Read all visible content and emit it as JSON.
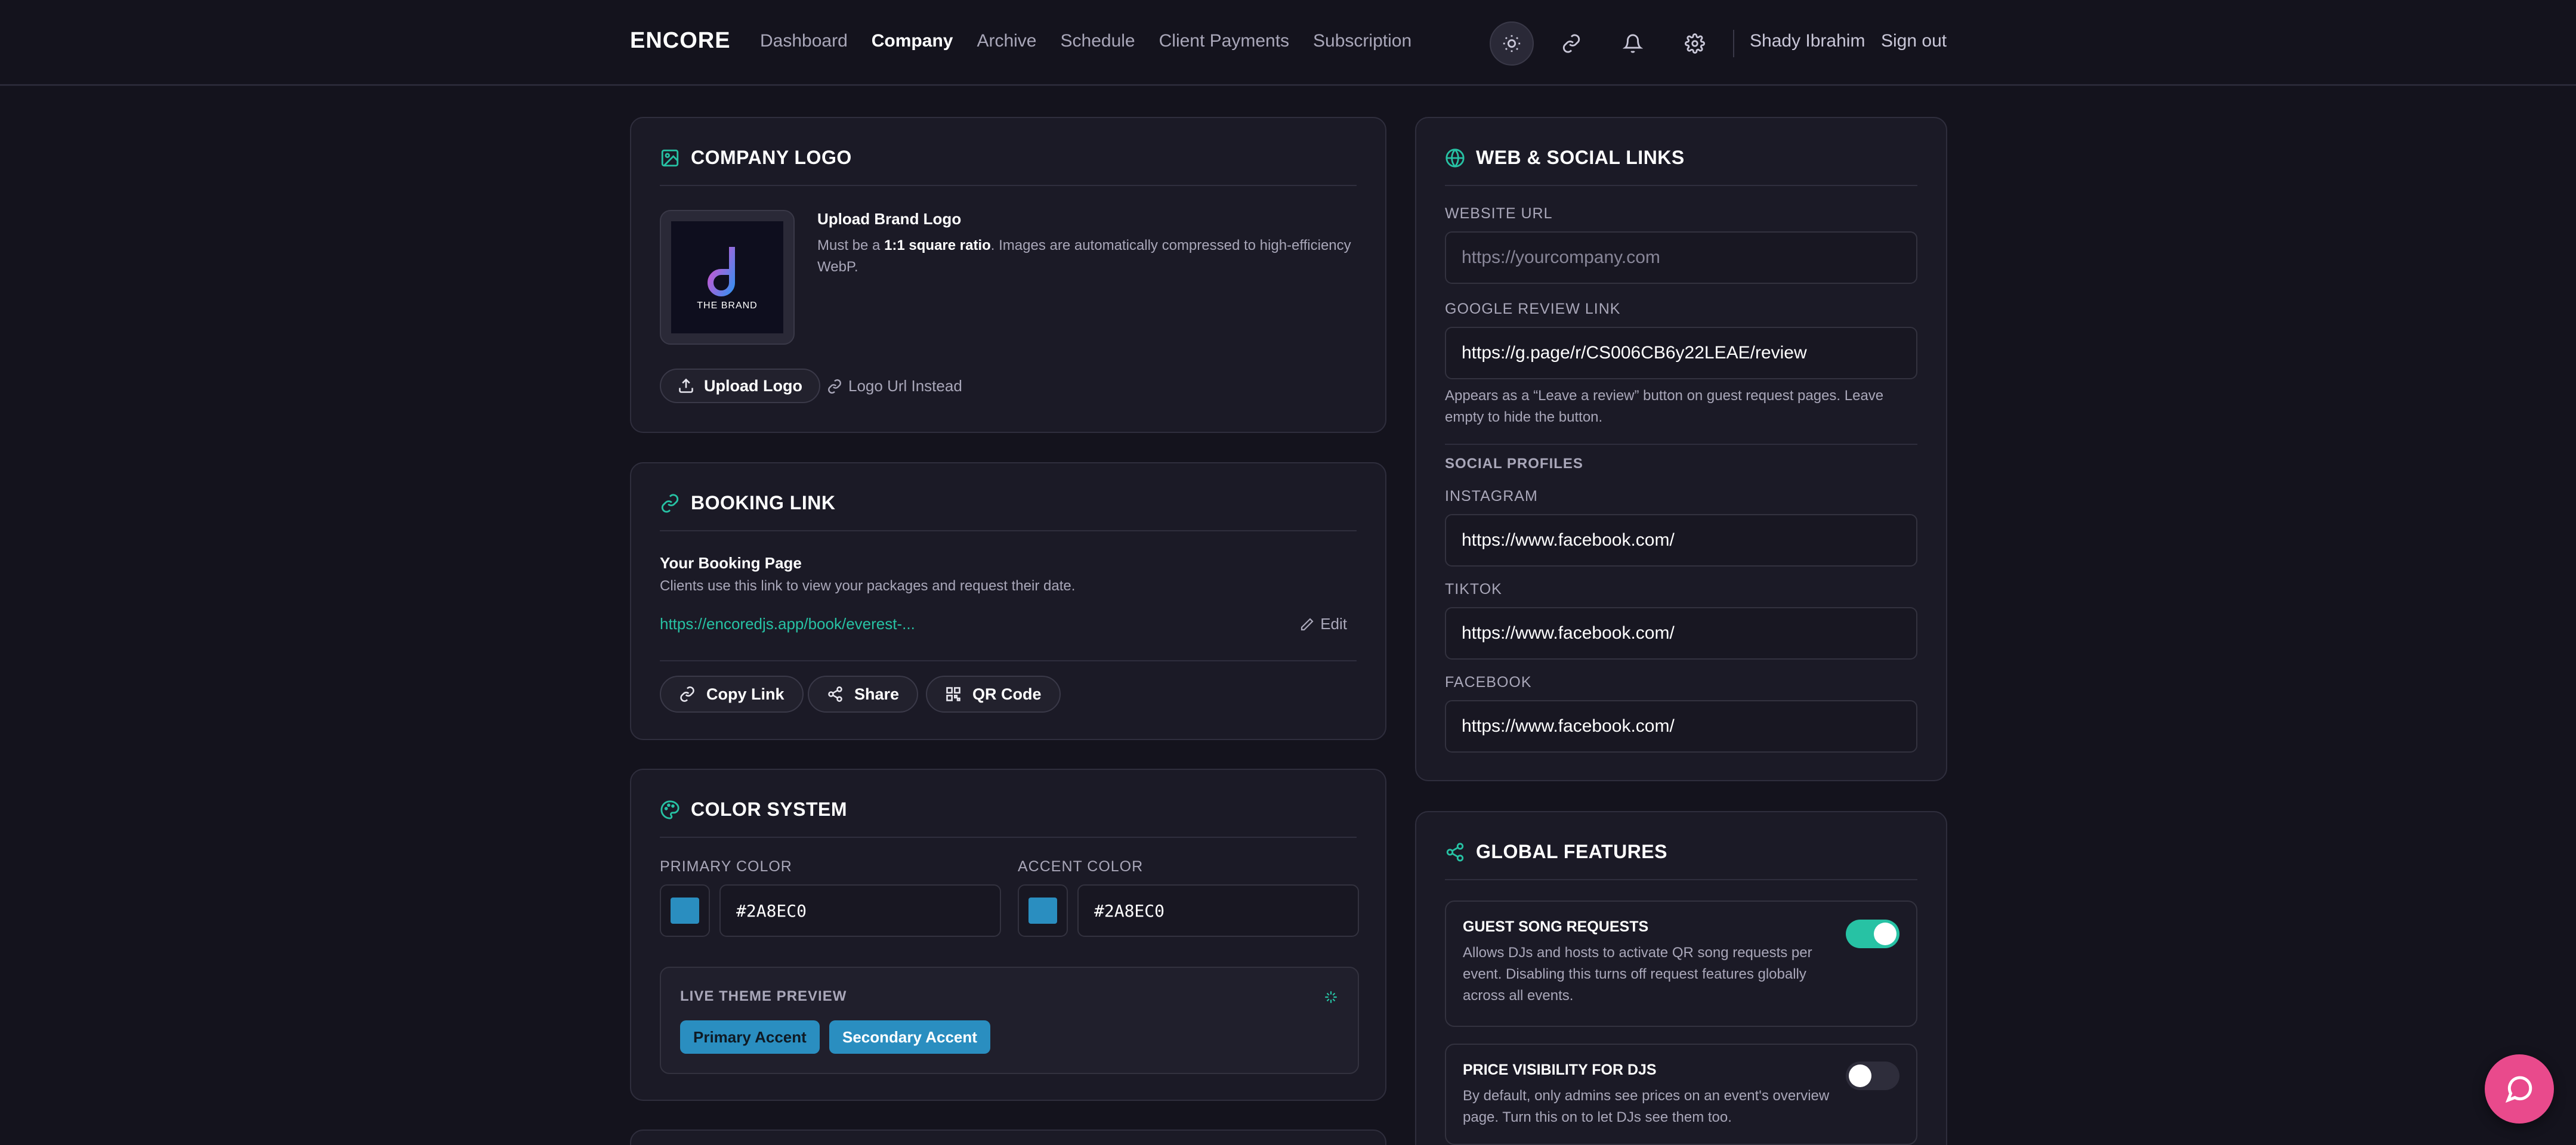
{
  "app": {
    "brand": "ENCORE",
    "nav": [
      "Dashboard",
      "Company",
      "Archive",
      "Schedule",
      "Client Payments",
      "Subscription"
    ],
    "active_nav": "Company",
    "user_name": "Shady Ibrahim",
    "sign_out": "Sign out"
  },
  "company_logo": {
    "title": "COMPANY LOGO",
    "logo_caption": "THE BRAND",
    "upload_heading": "Upload Brand Logo",
    "desc_prefix": "Must be a ",
    "desc_bold": "1:1 square ratio",
    "desc_suffix": ". Images are automatically compressed to high-efficiency WebP.",
    "upload_button": "Upload Logo",
    "url_link": "Logo Url Instead"
  },
  "booking_link": {
    "title": "BOOKING LINK",
    "heading": "Your Booking Page",
    "desc": "Clients use this link to view your packages and request their date.",
    "url": "https://encoredjs.app/book/everest-...",
    "edit": "Edit",
    "buttons": {
      "copy": "Copy Link",
      "share": "Share",
      "qr": "QR Code"
    }
  },
  "color_system": {
    "title": "COLOR SYSTEM",
    "primary_label": "PRIMARY COLOR",
    "primary_value": "#2A8EC0",
    "accent_label": "ACCENT COLOR",
    "accent_value": "#2A8EC0",
    "swatch_color": "#2a8ec0",
    "preview_label": "LIVE THEME PREVIEW",
    "primary_chip": "Primary Accent",
    "secondary_chip": "Secondary Accent"
  },
  "web_social": {
    "title": "WEB & SOCIAL LINKS",
    "website_label": "WEBSITE URL",
    "website_placeholder": "https://yourcompany.com",
    "google_label": "GOOGLE REVIEW LINK",
    "google_value": "https://g.page/r/CS006CB6y22LEAE/review",
    "google_help": "Appears as a “Leave a review” button on guest request pages. Leave empty to hide the button.",
    "profiles_heading": "SOCIAL PROFILES",
    "instagram_label": "INSTAGRAM",
    "instagram_value": "https://www.facebook.com/",
    "tiktok_label": "TIKTOK",
    "tiktok_value": "https://www.facebook.com/",
    "facebook_label": "FACEBOOK",
    "facebook_value": "https://www.facebook.com/"
  },
  "global_features": {
    "title": "GLOBAL FEATURES",
    "features": [
      {
        "name": "GUEST SONG REQUESTS",
        "desc": "Allows DJs and hosts to activate QR song requests per event. Disabling this turns off request features globally across all events.",
        "enabled": true
      },
      {
        "name": "PRICE VISIBILITY FOR DJS",
        "desc": "By default, only admins see prices on an event's overview page. Turn this on to let DJs see them too.",
        "enabled": false
      }
    ]
  },
  "colors": {
    "accent_teal": "#27c2a4",
    "toggle_on": "#27c2a4",
    "toggle_off": "#2e2d3b",
    "fab": "#e94a8c"
  }
}
